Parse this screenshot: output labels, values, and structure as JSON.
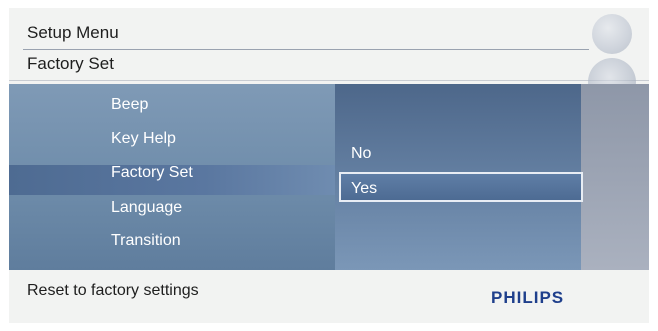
{
  "header": {
    "title": "Setup Menu",
    "subtitle": "Factory Set"
  },
  "menu": {
    "items": [
      {
        "label": "Beep"
      },
      {
        "label": "Key Help"
      },
      {
        "label": "Factory Set",
        "selected": true
      },
      {
        "label": "Language"
      },
      {
        "label": "Transition"
      }
    ]
  },
  "options": {
    "items": [
      {
        "label": "No"
      },
      {
        "label": "Yes",
        "selected": true
      }
    ]
  },
  "footer": {
    "hint": "Reset to factory settings",
    "brand": "PHILIPS"
  },
  "icons": {
    "top": "settings-dial-icon",
    "middle": "navigation-pad-icon",
    "bottom": "square-key-icon"
  },
  "colors": {
    "brand": "#1f3f8c",
    "menu_panel": "#6e8caa",
    "selected_highlight": "#4e6b92"
  }
}
